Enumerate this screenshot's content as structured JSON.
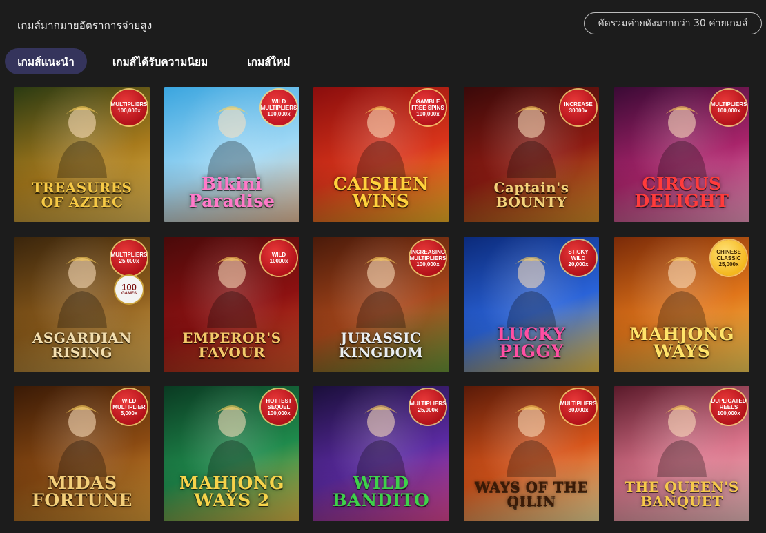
{
  "header": {
    "title": "เกมส์มากมายอัตราการจ่ายสูง",
    "provider_button": "คัดรวมค่ายดังมากกว่า 30 ค่ายเกมส์"
  },
  "tabs": [
    {
      "label": "เกมส์แนะนำ",
      "active": true
    },
    {
      "label": "เกมส์ได้รับความนิยม",
      "active": false
    },
    {
      "label": "เกมส์ใหม่",
      "active": false
    }
  ],
  "games": [
    {
      "title": "TREASURES OF AZTEC",
      "badge": "MULTIPLIERS\n100,000x",
      "colors": [
        "#2a3a12",
        "#a77a1c",
        "#e9c15a"
      ],
      "text_color": "#f6c945",
      "badge_color": "#b3121a"
    },
    {
      "title": "Bikini Paradise",
      "badge": "WILD\nMULTIPLIERS\n100,000x",
      "colors": [
        "#3aa5df",
        "#9fd8f5",
        "#f3c7a1"
      ],
      "text_color": "#ff79c9",
      "badge_color": "#c21622"
    },
    {
      "title": "CAISHEN WINS",
      "badge": "GAMBLE\nFREE SPINS\n100,000x",
      "colors": [
        "#8a0d0d",
        "#d8341a",
        "#f5b828"
      ],
      "text_color": "#ffd23c",
      "badge_color": "#b3121a"
    },
    {
      "title": "Captain's BOUNTY",
      "badge": "INCREASE\n30000x",
      "colors": [
        "#3a0909",
        "#8c1b12",
        "#e0962b"
      ],
      "text_color": "#f4d27a",
      "badge_color": "#b3121a"
    },
    {
      "title": "CIRCUS DELIGHT",
      "badge": "MULTIPLIERS\n100,000x",
      "colors": [
        "#3a0a35",
        "#a8246a",
        "#f6a0c6"
      ],
      "text_color": "#ff3b3b",
      "badge_color": "#b3121a"
    },
    {
      "title": "ASGARDIAN RISING",
      "badge": "MULTIPLIERS\n25,000x",
      "stamp": "100",
      "stamp_sub": "GAMES",
      "colors": [
        "#3a250c",
        "#8a5a1a",
        "#e5b75a"
      ],
      "text_color": "#f3dfb0",
      "badge_color": "#b3121a"
    },
    {
      "title": "EMPEROR'S FAVOUR",
      "badge": "WILD\n10000x",
      "colors": [
        "#4a0a0a",
        "#8c1111",
        "#d8572a"
      ],
      "text_color": "#f3c96a",
      "badge_color": "#b3121a"
    },
    {
      "title": "JURASSIC KINGDOM",
      "badge": "INCREASING\nMULTIPLIERS\n100,000x",
      "colors": [
        "#4a1a0a",
        "#a6461a",
        "#6d9a3a"
      ],
      "text_color": "#e9eef2",
      "badge_color": "#b3121a"
    },
    {
      "title": "LUCKY PIGGY",
      "badge": "STICKY\nWILD\n20,000x",
      "colors": [
        "#0b2a7a",
        "#2a63d8",
        "#f3c84a"
      ],
      "text_color": "#ff4fa3",
      "badge_color": "#b3121a"
    },
    {
      "title": "MAHJONG WAYS",
      "badge": "CHINESE\nCLASSIC\n25,000x",
      "colors": [
        "#7a2a08",
        "#e0751a",
        "#fbd45a"
      ],
      "text_color": "#ffe46a",
      "badge_color": "#f4b81e",
      "badge_light": true
    },
    {
      "title": "MIDAS FORTUNE",
      "badge": "WILD\nMULTIPLIER\n5,000x",
      "colors": [
        "#3a1a06",
        "#8a4a12",
        "#e3a13a"
      ],
      "text_color": "#f3cf7a",
      "badge_color": "#b3121a"
    },
    {
      "title": "MAHJONG WAYS 2",
      "badge": "HOTTEST\nSEQUEL\n100,000x",
      "colors": [
        "#0a3a22",
        "#1f8a4c",
        "#e7c04a"
      ],
      "text_color": "#f7d34a",
      "badge_color": "#b3121a"
    },
    {
      "title": "WILD BANDITO",
      "badge": "MULTIPLIERS\n25,000x",
      "colors": [
        "#1a0f3a",
        "#5a2aa0",
        "#e84a9a"
      ],
      "text_color": "#3ed14a",
      "badge_color": "#b3121a"
    },
    {
      "title": "WAYS OF THE QILIN",
      "badge": "MULTIPLIERS\n80,000x",
      "colors": [
        "#5a1a08",
        "#d6541a",
        "#fbe6a0"
      ],
      "text_color": "#3a1a06",
      "badge_color": "#b3121a"
    },
    {
      "title": "THE QUEEN'S BANQUET",
      "badge": "DUPLICATED\nREELS\n100,000x",
      "colors": [
        "#5a1a2a",
        "#d9738a",
        "#f8c8c8"
      ],
      "text_color": "#f6c94a",
      "badge_color": "#b3121a"
    }
  ]
}
